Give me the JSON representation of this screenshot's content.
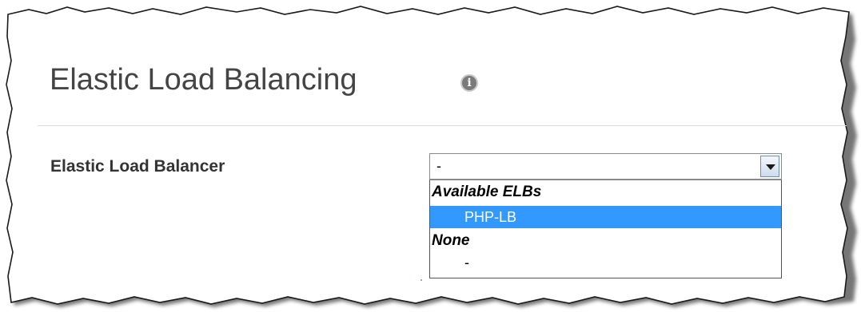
{
  "section": {
    "title": "Elastic Load Balancing",
    "info_icon_glyph": "i",
    "info_icon_name": "info-icon"
  },
  "field": {
    "label": "Elastic Load Balancer",
    "selected_value": "-",
    "arrow_icon_name": "chevron-down-icon"
  },
  "dropdown": {
    "groups": [
      {
        "label": "Available ELBs",
        "options": [
          {
            "label": "PHP-LB",
            "highlighted": true
          }
        ]
      },
      {
        "label": "None",
        "options": [
          {
            "label": "-",
            "highlighted": false
          }
        ]
      }
    ]
  },
  "colors": {
    "title_text": "#444444",
    "label_text": "#333333",
    "highlight_bg": "#3399ff",
    "highlight_text": "#ffffff",
    "divider": "#dcdcdc"
  }
}
